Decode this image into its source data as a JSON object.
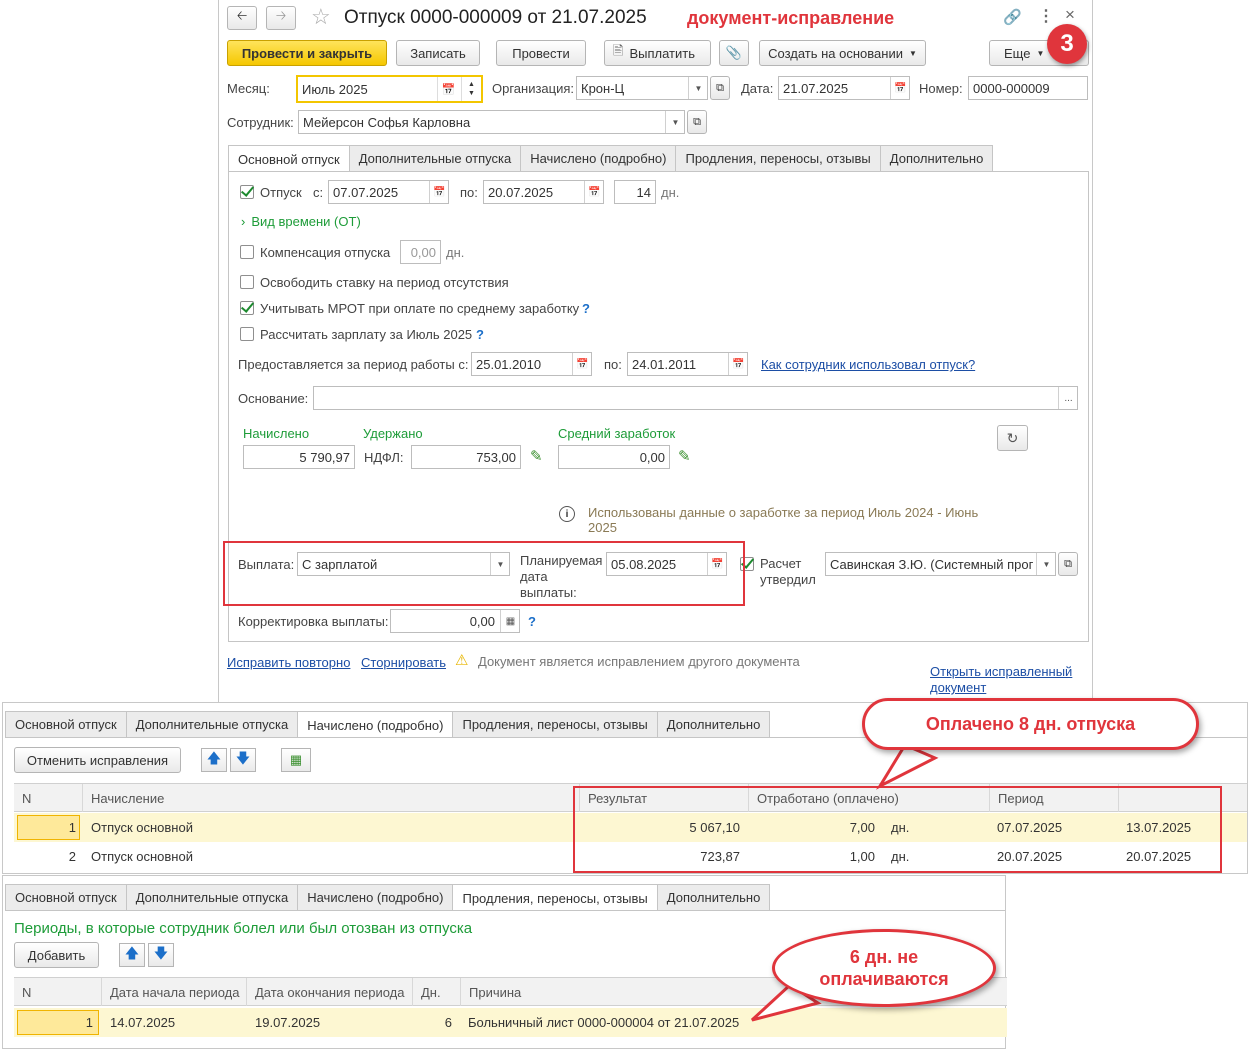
{
  "window": {
    "title": "Отпуск 0000-000009 от 21.07.2025",
    "annotation": "документ-исправление",
    "badge": "3"
  },
  "toolbar": {
    "post_close": "Провести и закрыть",
    "save": "Записать",
    "post": "Провести",
    "pay": "Выплатить",
    "create_based": "Создать на основании",
    "more": "Еще"
  },
  "header": {
    "month_label": "Месяц:",
    "month_value": "Июль 2025",
    "org_label": "Организация:",
    "org_value": "Крон-Ц",
    "date_label": "Дата:",
    "date_value": "21.07.2025",
    "number_label": "Номер:",
    "number_value": "0000-000009",
    "employee_label": "Сотрудник:",
    "employee_value": "Мейерсон Софья Карловна"
  },
  "tabs": [
    "Основной отпуск",
    "Дополнительные отпуска",
    "Начислено (подробно)",
    "Продления, переносы, отзывы",
    "Дополнительно"
  ],
  "main": {
    "vacation_label": "Отпуск",
    "from_label": "с:",
    "from_value": "07.07.2025",
    "to_label": "по:",
    "to_value": "20.07.2025",
    "days_value": "14",
    "days_unit": "дн.",
    "time_kind": "Вид времени (ОТ)",
    "compensation_label": "Компенсация отпуска",
    "compensation_value": "0,00",
    "compensation_unit": "дн.",
    "release_rate": "Освободить ставку на период отсутствия",
    "mrot": "Учитывать МРОТ при оплате по среднему заработку",
    "calc_salary": "Рассчитать зарплату за Июль 2025",
    "help_mark": "?",
    "period_label": "Предоставляется за период работы с:",
    "period_from": "25.01.2010",
    "period_to_label": "по:",
    "period_to": "24.01.2011",
    "period_link": "Как сотрудник использовал отпуск?",
    "basis_label": "Основание:",
    "basis_value": "",
    "basis_btn": "...",
    "accrued_label": "Начислено",
    "accrued_value": "5 790,97",
    "withheld_label": "Удержано",
    "ndfl_label": "НДФЛ:",
    "ndfl_value": "753,00",
    "avg_label": "Средний заработок",
    "avg_value": "0,00",
    "info_text": "Использованы данные о заработке за период Июль 2024 - Июнь 2025",
    "payout_label": "Выплата:",
    "payout_value": "С зарплатой",
    "planned_label": "Планируемая дата выплаты:",
    "planned_value": "05.08.2025",
    "approved_label": "Расчет утвердил",
    "approved_value": "Савинская З.Ю. (Системный прог",
    "correction_label": "Корректировка выплаты:",
    "correction_value": "0,00"
  },
  "footer": {
    "fix_again": "Исправить повторно",
    "reverse": "Сторнировать",
    "warning": "Документ является исправлением другого документа",
    "open_fixed": "Открыть исправленный документ"
  },
  "accrued_panel": {
    "cancel_btn": "Отменить исправления",
    "columns": [
      "N",
      "Начисление",
      "Результат",
      "Отработано (оплачено)",
      "Период"
    ],
    "rows": [
      {
        "n": "1",
        "name": "Отпуск основной",
        "result": "5 067,10",
        "worked": "7,00",
        "unit": "дн.",
        "from": "07.07.2025",
        "to": "13.07.2025"
      },
      {
        "n": "2",
        "name": "Отпуск основной",
        "result": "723,87",
        "worked": "1,00",
        "unit": "дн.",
        "from": "20.07.2025",
        "to": "20.07.2025"
      }
    ],
    "callout": "Оплачено 8 дн. отпуска"
  },
  "extensions_panel": {
    "heading": "Периоды, в которые сотрудник болел или был отозван из отпуска",
    "add_btn": "Добавить",
    "columns": [
      "N",
      "Дата начала периода",
      "Дата окончания периода",
      "Дн.",
      "Причина"
    ],
    "rows": [
      {
        "n": "1",
        "start": "14.07.2025",
        "end": "19.07.2025",
        "days": "6",
        "reason": "Больничный лист 0000-000004 от 21.07.2025"
      }
    ],
    "callout": "6 дн. не оплачиваются"
  },
  "colors": {
    "accent_yellow": "#f5c700",
    "link": "#1c4ea5",
    "green_label": "#1e9c39",
    "annotation_red": "#e0353c",
    "selected_row": "#fdf7d2"
  }
}
